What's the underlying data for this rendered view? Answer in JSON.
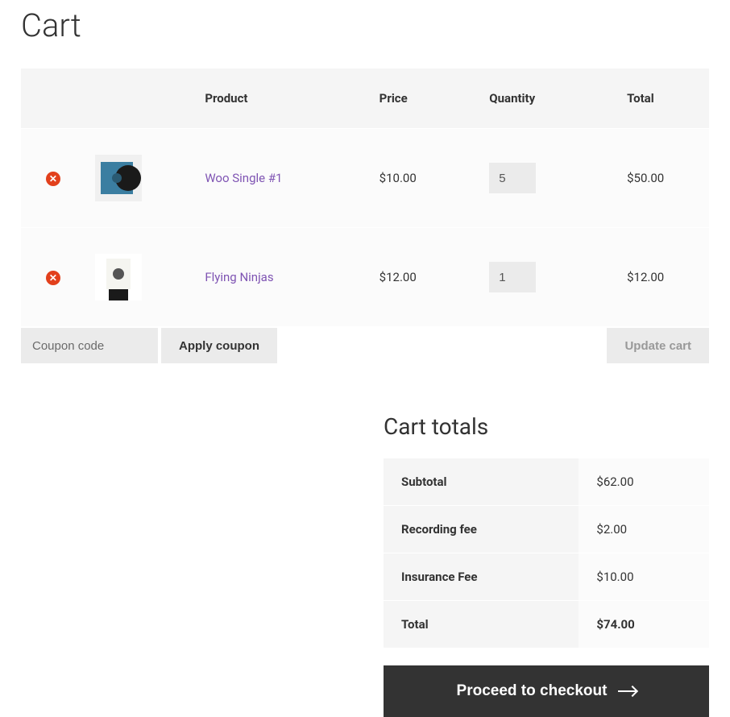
{
  "page_title": "Cart",
  "table": {
    "headers": {
      "product": "Product",
      "price": "Price",
      "quantity": "Quantity",
      "total": "Total"
    },
    "items": [
      {
        "name": "Woo Single #1",
        "price": "$10.00",
        "quantity": "5",
        "total": "$50.00"
      },
      {
        "name": "Flying Ninjas",
        "price": "$12.00",
        "quantity": "1",
        "total": "$12.00"
      }
    ]
  },
  "coupon": {
    "placeholder": "Coupon code",
    "apply_label": "Apply coupon"
  },
  "update_label": "Update cart",
  "totals": {
    "heading": "Cart totals",
    "rows": [
      {
        "label": "Subtotal",
        "value": "$62.00"
      },
      {
        "label": "Recording fee",
        "value": "$2.00"
      },
      {
        "label": "Insurance Fee",
        "value": "$10.00"
      }
    ],
    "total_label": "Total",
    "total_value": "$74.00"
  },
  "checkout_label": "Proceed to checkout"
}
